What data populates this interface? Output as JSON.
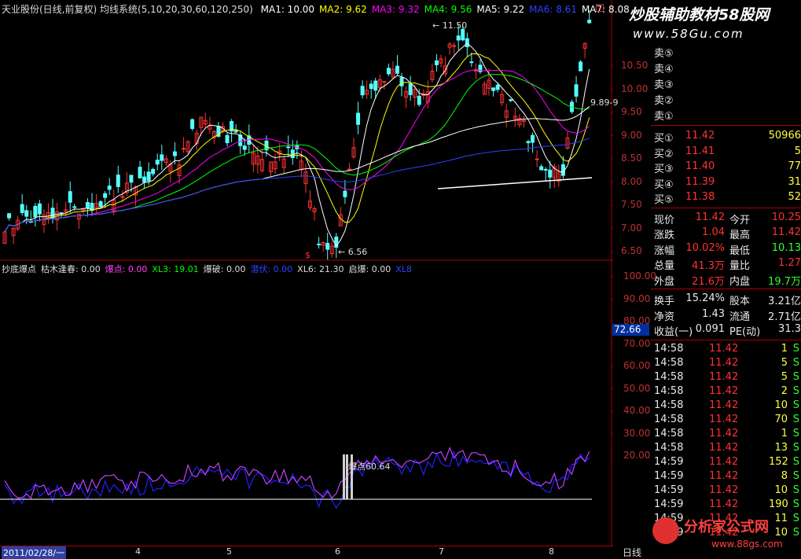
{
  "title_bar": {
    "stock": "天业股份(日线,前复权)",
    "system": "均线系统(5,10,20,30,60,120,250)",
    "ma": [
      {
        "label": "MA1: 10.00",
        "color": "#ffffff"
      },
      {
        "label": "MA2: 9.62",
        "color": "#ffff00"
      },
      {
        "label": "MA3: 9.32",
        "color": "#ff00ff"
      },
      {
        "label": "MA4: 9.56",
        "color": "#00ff00"
      },
      {
        "label": "MA5: 9.22",
        "color": "#ffffff"
      },
      {
        "label": "MA6: 8.61",
        "color": "#3040ff"
      },
      {
        "label": "MA7: 8.08",
        "color": "#ffffff"
      }
    ]
  },
  "watermark_top": "炒股辅助教材58股网",
  "watermark_url": "www.58Gu.com",
  "price_axis": [
    "10.50",
    "10.00",
    "9.50",
    "9.00",
    "8.50",
    "8.00",
    "7.50",
    "7.00",
    "6.50"
  ],
  "price_annotations": {
    "high": "11.50",
    "low": "6.56",
    "right": "9.89-9"
  },
  "indicator_bar": {
    "items": [
      {
        "label": "抄底爆点",
        "color": "#dddddd"
      },
      {
        "label": "枯木逢春: 0.00",
        "color": "#dddddd"
      },
      {
        "label": "爆点: 0.00",
        "color": "#ff40ff"
      },
      {
        "label": "XL3: 19.01",
        "color": "#00ff00"
      },
      {
        "label": "爆破: 0.00",
        "color": "#dddddd"
      },
      {
        "label": "潜伏: 0.00",
        "color": "#3040ff"
      },
      {
        "label": "XL6: 21.30",
        "color": "#dddddd"
      },
      {
        "label": "启爆: 0.00",
        "color": "#dddddd"
      },
      {
        "label": "XL8",
        "color": "#3040ff"
      }
    ]
  },
  "indicator_axis": [
    "100.00",
    "90.00",
    "80.00",
    "70.00",
    "60.00",
    "50.00",
    "40.00",
    "30.00",
    "20.00"
  ],
  "indicator_current": "72.66",
  "indicator_annotation": "爆点60.64",
  "date_axis": {
    "start": "2011/02/28/一",
    "months": [
      "4",
      "5",
      "6",
      "7",
      "8"
    ]
  },
  "period_label": "日线",
  "order_book": {
    "sell": [
      "卖⑤",
      "卖④",
      "卖③",
      "卖②",
      "卖①"
    ],
    "buy": [
      {
        "label": "买①",
        "price": "11.42",
        "vol": "50966"
      },
      {
        "label": "买②",
        "price": "11.41",
        "vol": "5"
      },
      {
        "label": "买③",
        "price": "11.40",
        "vol": "77"
      },
      {
        "label": "买④",
        "price": "11.39",
        "vol": "31"
      },
      {
        "label": "买⑤",
        "price": "11.38",
        "vol": "52"
      }
    ]
  },
  "quote_rows": [
    {
      "l1": "现价",
      "v1": "11.42",
      "l2": "今开",
      "v2": "10.25"
    },
    {
      "l1": "涨跌",
      "v1": "1.04",
      "l2": "最高",
      "v2": "11.42"
    },
    {
      "l1": "涨幅",
      "v1": "10.02%",
      "l2": "最低",
      "v2": "10.13"
    },
    {
      "l1": "总量",
      "v1": "41.3万",
      "l2": "量比",
      "v2": "1.27"
    },
    {
      "l1": "外盘",
      "v1": "21.6万",
      "l2": "内盘",
      "v2": "19.7万"
    }
  ],
  "stats_rows": [
    {
      "l1": "换手",
      "v1": "15.24%",
      "l2": "股本",
      "v2": "3.21亿"
    },
    {
      "l1": "净资",
      "v1": "1.43",
      "l2": "流通",
      "v2": "2.71亿"
    },
    {
      "l1": "收益(一)",
      "v1": "0.091",
      "l2": "PE(动)",
      "v2": "31.3"
    }
  ],
  "ticks": [
    {
      "time": "14:58",
      "price": "11.42",
      "vol": "1",
      "side": "S"
    },
    {
      "time": "14:58",
      "price": "11.42",
      "vol": "5",
      "side": "S"
    },
    {
      "time": "14:58",
      "price": "11.42",
      "vol": "5",
      "side": "S"
    },
    {
      "time": "14:58",
      "price": "11.42",
      "vol": "2",
      "side": "S"
    },
    {
      "time": "14:58",
      "price": "11.42",
      "vol": "10",
      "side": "S"
    },
    {
      "time": "14:58",
      "price": "11.42",
      "vol": "70",
      "side": "S"
    },
    {
      "time": "14:58",
      "price": "11.42",
      "vol": "1",
      "side": "S"
    },
    {
      "time": "14:58",
      "price": "11.42",
      "vol": "13",
      "side": "S"
    },
    {
      "time": "14:59",
      "price": "11.42",
      "vol": "152",
      "side": "S"
    },
    {
      "time": "14:59",
      "price": "11.42",
      "vol": "8",
      "side": "S"
    },
    {
      "time": "14:59",
      "price": "11.42",
      "vol": "10",
      "side": "S"
    },
    {
      "time": "14:59",
      "price": "11.42",
      "vol": "190",
      "side": "S"
    },
    {
      "time": "14:59",
      "price": "11.42",
      "vol": "11",
      "side": "S"
    },
    {
      "time": "14:59",
      "price": "11.42",
      "vol": "10",
      "side": "S"
    }
  ],
  "watermark_bottom": "分析家公式网",
  "watermark_bottom_url": "www.88gs.com",
  "colors": {
    "up": "#ff3232",
    "down": "#54ffff",
    "axis": "#a00000",
    "label": "#e8e8e8"
  }
}
